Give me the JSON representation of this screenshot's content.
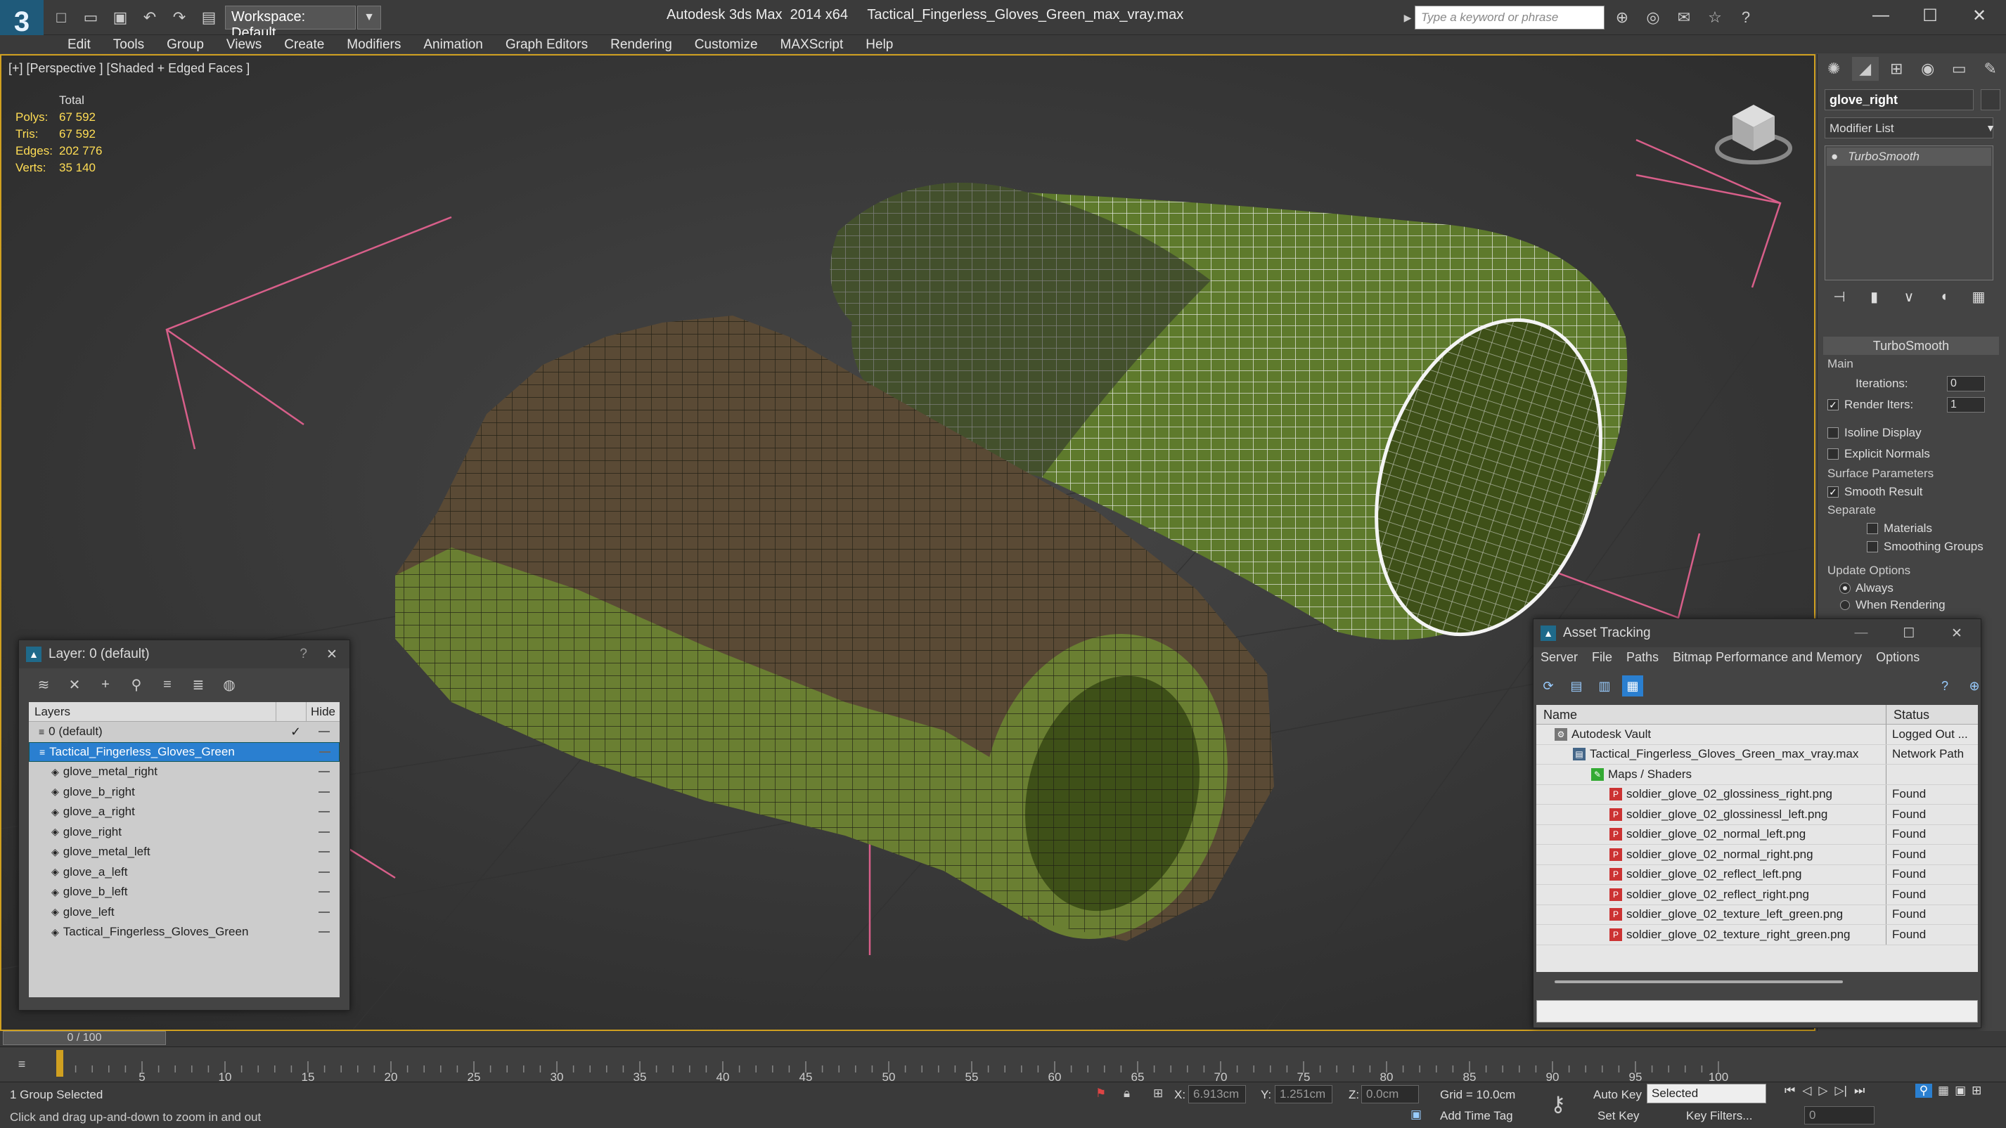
{
  "app": {
    "title": "Autodesk 3ds Max  2014 x64",
    "file": "Tactical_Fingerless_Gloves_Green_max_vray.max",
    "logo_glyph": "3"
  },
  "quick_access": {
    "workspace": "Workspace: Default"
  },
  "search": {
    "placeholder": "Type a keyword or phrase"
  },
  "menu": [
    "Edit",
    "Tools",
    "Group",
    "Views",
    "Create",
    "Modifiers",
    "Animation",
    "Graph Editors",
    "Rendering",
    "Customize",
    "MAXScript",
    "Help"
  ],
  "viewport": {
    "label": "[+] [Perspective ] [Shaded + Edged Faces ]",
    "stats": {
      "header": "Total",
      "rows": [
        {
          "k": "Polys:",
          "v": "67 592"
        },
        {
          "k": "Tris:",
          "v": "67 592"
        },
        {
          "k": "Edges:",
          "v": "202 776"
        },
        {
          "k": "Verts:",
          "v": "35 140"
        }
      ]
    }
  },
  "command_panel": {
    "object_name": "glove_right",
    "modifier_list": "Modifier List",
    "stack_item": "TurboSmooth",
    "rollout": {
      "title": "TurboSmooth",
      "main": "Main",
      "iterations_label": "Iterations:",
      "iterations": "0",
      "render_iters_label": "Render Iters:",
      "render_iters": "1",
      "isoline": "Isoline Display",
      "explicit": "Explicit Normals",
      "surface": "Surface Parameters",
      "smooth": "Smooth Result",
      "separate": "Separate",
      "materials": "Materials",
      "smoothing": "Smoothing Groups",
      "update": "Update Options",
      "always": "Always",
      "when": "When Rendering"
    }
  },
  "layer_panel": {
    "title": "Layer: 0 (default)",
    "help": "?",
    "col_layers": "Layers",
    "col_hide": "Hide",
    "rows": [
      {
        "name": "0 (default)",
        "level": 0,
        "check": "✓",
        "selected": false
      },
      {
        "name": "Tactical_Fingerless_Gloves_Green",
        "level": 0,
        "check": "",
        "selected": true
      },
      {
        "name": "glove_metal_right",
        "level": 1,
        "check": "",
        "selected": false
      },
      {
        "name": "glove_b_right",
        "level": 1,
        "check": "",
        "selected": false
      },
      {
        "name": "glove_a_right",
        "level": 1,
        "check": "",
        "selected": false
      },
      {
        "name": "glove_right",
        "level": 1,
        "check": "",
        "selected": false
      },
      {
        "name": "glove_metal_left",
        "level": 1,
        "check": "",
        "selected": false
      },
      {
        "name": "glove_a_left",
        "level": 1,
        "check": "",
        "selected": false
      },
      {
        "name": "glove_b_left",
        "level": 1,
        "check": "",
        "selected": false
      },
      {
        "name": "glove_left",
        "level": 1,
        "check": "",
        "selected": false
      },
      {
        "name": "Tactical_Fingerless_Gloves_Green",
        "level": 1,
        "check": "",
        "selected": false
      }
    ]
  },
  "asset_panel": {
    "title": "Asset Tracking",
    "menu": [
      "Server",
      "File",
      "Paths",
      "Bitmap Performance and Memory",
      "Options"
    ],
    "col_name": "Name",
    "col_status": "Status",
    "rows": [
      {
        "name": "Autodesk Vault",
        "level": 1,
        "status": "Logged Out ...",
        "icon": "vault"
      },
      {
        "name": "Tactical_Fingerless_Gloves_Green_max_vray.max",
        "level": 2,
        "status": "Network Path",
        "icon": "max"
      },
      {
        "name": "Maps / Shaders",
        "level": 3,
        "status": "",
        "icon": "maps"
      },
      {
        "name": "soldier_glove_02_glossiness_right.png",
        "level": 4,
        "status": "Found",
        "icon": "png"
      },
      {
        "name": "soldier_glove_02_glossinessl_left.png",
        "level": 4,
        "status": "Found",
        "icon": "png"
      },
      {
        "name": "soldier_glove_02_normal_left.png",
        "level": 4,
        "status": "Found",
        "icon": "png"
      },
      {
        "name": "soldier_glove_02_normal_right.png",
        "level": 4,
        "status": "Found",
        "icon": "png"
      },
      {
        "name": "soldier_glove_02_reflect_left.png",
        "level": 4,
        "status": "Found",
        "icon": "png"
      },
      {
        "name": "soldier_glove_02_reflect_right.png",
        "level": 4,
        "status": "Found",
        "icon": "png"
      },
      {
        "name": "soldier_glove_02_texture_left_green.png",
        "level": 4,
        "status": "Found",
        "icon": "png"
      },
      {
        "name": "soldier_glove_02_texture_right_green.png",
        "level": 4,
        "status": "Found",
        "icon": "png"
      }
    ]
  },
  "timeline": {
    "frame": "0 / 100",
    "ticks": [
      "5",
      "10",
      "15",
      "20",
      "25",
      "30",
      "35",
      "40",
      "45",
      "50",
      "55",
      "60",
      "65",
      "70",
      "75",
      "80",
      "85",
      "90",
      "95",
      "100"
    ]
  },
  "status": {
    "selection": "1 Group Selected",
    "prompt": "Click and drag up-and-down to zoom in and out",
    "x_label": "X:",
    "x": "6.913cm",
    "y_label": "Y:",
    "y": "1.251cm",
    "z_label": "Z:",
    "z": "0.0cm",
    "grid": "Grid = 10.0cm",
    "auto_key": "Auto Key",
    "selected": "Selected",
    "set_key": "Set Key",
    "key_filters": "Key Filters...",
    "add_time_tag": "Add Time Tag",
    "frame": "0"
  },
  "colors": {
    "accent": "#d0a020",
    "selection": "#2a7fd0",
    "glove_green": "#5e7a2c",
    "glove_brown": "#5a4a35"
  }
}
